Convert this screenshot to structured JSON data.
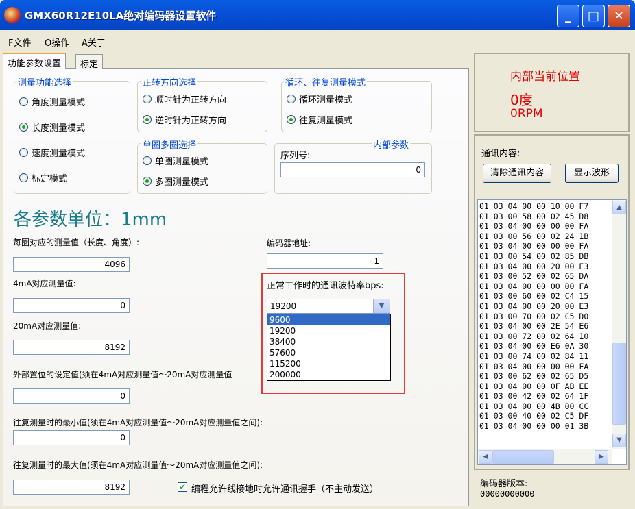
{
  "window": {
    "title": "GMX60R12E10LA绝对编码器设置软件",
    "min": "_",
    "max": "□",
    "close": "✕"
  },
  "menu": [
    {
      "key": "F",
      "label": "文件"
    },
    {
      "key": "O",
      "label": "操作"
    },
    {
      "key": "A",
      "label": "关于"
    }
  ],
  "tabs": [
    {
      "label": "功能参数设置"
    },
    {
      "label": "标定"
    }
  ],
  "measure_group": {
    "title": "测量功能选择",
    "options": [
      {
        "label": "角度测量模式",
        "checked": false
      },
      {
        "label": "长度测量模式",
        "checked": true
      },
      {
        "label": "速度测量模式",
        "checked": false
      },
      {
        "label": "标定模式",
        "checked": false
      }
    ]
  },
  "direction_group": {
    "title": "正转方向选择",
    "options": [
      {
        "label": "顺时针为正转方向",
        "checked": false
      },
      {
        "label": "逆时针为正转方向",
        "checked": true
      }
    ]
  },
  "cycle_group": {
    "title": "循环、往复测量模式",
    "options": [
      {
        "label": "循环测量模式",
        "checked": false
      },
      {
        "label": "往复测量模式",
        "checked": true
      }
    ]
  },
  "turn_group": {
    "title": "单圈多圈选择",
    "options": [
      {
        "label": "单圈测量模式",
        "checked": false
      },
      {
        "label": "多圈测量模式",
        "checked": true
      }
    ]
  },
  "internal_group": {
    "title": "内部参数",
    "serial_label": "序列号:",
    "serial_value": "0"
  },
  "unit_title": "各参数单位：1mm",
  "fields": {
    "per_turn_label": "每圈对应的测量值（长度、角度）:",
    "per_turn_value": "4096",
    "ma4_label": "4mA对应测量值:",
    "ma4_value": "0",
    "ma20_label": "20mA对应测量值:",
    "ma20_value": "8192",
    "ext_label": "外部置位的设定值(须在4mA对应测量值～20mA对应测量值",
    "ext_value": "0",
    "min_label": "往复测量时的最小值(须在4mA对应测量值～20mA对应测量值之间):",
    "min_value": "0",
    "max_label": "往复测量时的最大值(须在4mA对应测量值～20mA对应测量值之间):",
    "max_value": "8192",
    "addr_label": "编码器地址:",
    "addr_value": "1"
  },
  "baud": {
    "label": "正常工作时的通讯波特率bps:",
    "selected": "19200",
    "options": [
      "9600",
      "19200",
      "38400",
      "57600",
      "115200",
      "200000"
    ],
    "highlighted": 0
  },
  "allow_check": {
    "label": "编程允许线接地时允许通讯握手（不主动发送）",
    "checked": true,
    "mark": "✔"
  },
  "position": {
    "title": "内部当前位置",
    "angle": "0度",
    "speed": "0RPM"
  },
  "comm": {
    "label": "通讯内容:",
    "clear_btn": "清除通讯内容",
    "wave_btn": "显示波形",
    "log": [
      "01 03 04 00 00 10 00 F7",
      "01 03 00 58 00 02 45 D8",
      "01 03 04 00 00 00 00 FA",
      "01 03 00 56 00 02 24 1B",
      "01 03 04 00 00 00 00 FA",
      "01 03 00 54 00 02 85 DB",
      "01 03 04 00 00 20 00 E3",
      "01 03 00 52 00 02 65 DA",
      "01 03 04 00 00 00 00 FA",
      "01 03 00 60 00 02 C4 15",
      "01 03 04 00 00 20 00 E3",
      "01 03 00 70 00 02 C5 D0",
      "01 03 04 00 00 2E 54 E6",
      "01 03 00 72 00 02 64 10",
      "01 03 04 00 00 E6 0A 30",
      "01 03 00 74 00 02 84 11",
      "01 03 04 00 00 00 00 FA",
      "01 03 00 62 00 02 65 D5",
      "01 03 04 00 00 0F AB EE",
      "01 03 00 42 00 02 64 1F",
      "01 03 04 00 00 4B 00 CC",
      "01 03 00 40 00 02 C5 DF",
      "01 03 04 00 00 00 01 3B"
    ]
  },
  "version": {
    "label": "编码器版本:",
    "value": "00000000000"
  }
}
